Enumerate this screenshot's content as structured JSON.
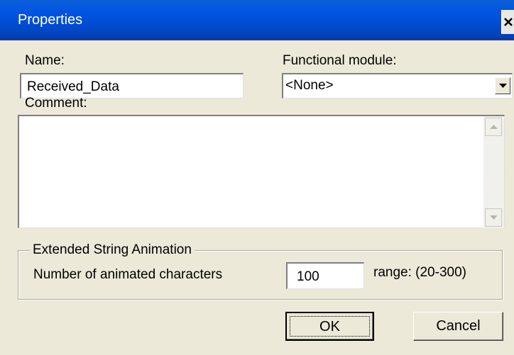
{
  "window": {
    "title": "Properties",
    "close_icon": "close-x-icon"
  },
  "name": {
    "label": "Name:",
    "value": "Received_Data"
  },
  "functional_module": {
    "label": "Functional module:",
    "selected": "<None>"
  },
  "comment": {
    "label": "Comment:",
    "value": ""
  },
  "extended_animation": {
    "group_title": "Extended String Animation",
    "chars_label": "Number of animated characters",
    "chars_value": "100",
    "range_text": "range: (20-300)"
  },
  "buttons": {
    "ok": "OK",
    "cancel": "Cancel"
  },
  "colors": {
    "titlebar": "#0054e3",
    "dialog_bg": "#ece9d8"
  }
}
